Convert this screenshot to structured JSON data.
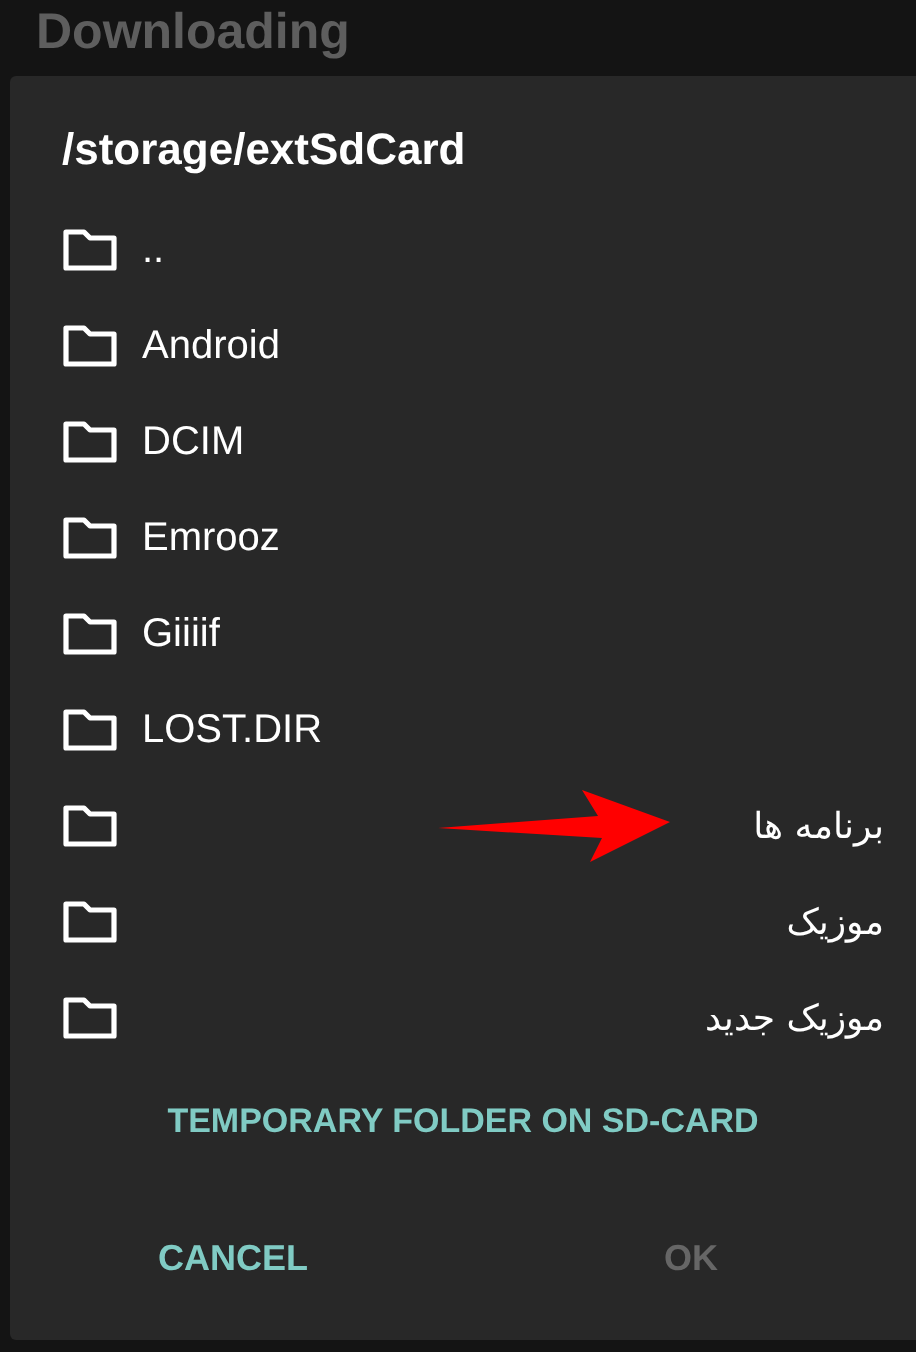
{
  "background_title": "Downloading",
  "dialog": {
    "title": "/storage/extSdCard",
    "folders": [
      {
        "name": "..",
        "right_aligned": false,
        "marked": false
      },
      {
        "name": "Android",
        "right_aligned": false,
        "marked": false
      },
      {
        "name": "DCIM",
        "right_aligned": false,
        "marked": false
      },
      {
        "name": "Emrooz",
        "right_aligned": false,
        "marked": false
      },
      {
        "name": "Giiiif",
        "right_aligned": false,
        "marked": false
      },
      {
        "name": "LOST.DIR",
        "right_aligned": false,
        "marked": false
      },
      {
        "name": "برنامه ها",
        "right_aligned": true,
        "marked": true
      },
      {
        "name": "موزیک",
        "right_aligned": true,
        "marked": false
      },
      {
        "name": "موزیک جدید",
        "right_aligned": true,
        "marked": false
      }
    ],
    "link": "TEMPORARY FOLDER ON SD-CARD",
    "buttons": [
      {
        "label": "CANCEL",
        "disabled": false
      },
      {
        "label": "OK",
        "disabled": true
      }
    ]
  }
}
